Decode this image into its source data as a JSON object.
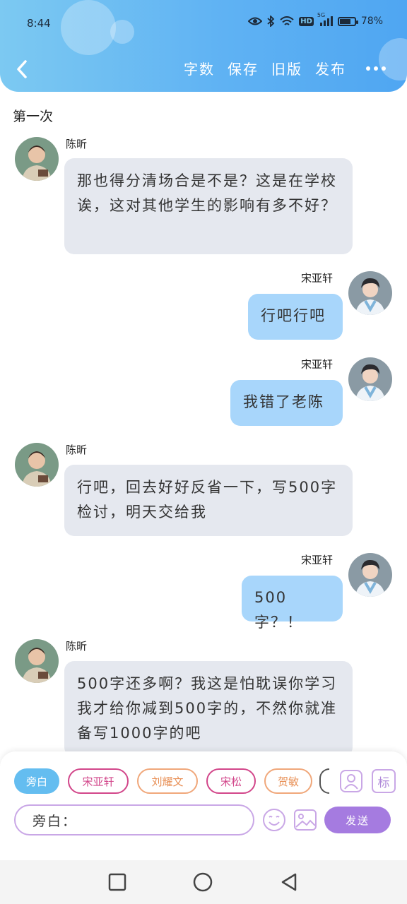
{
  "status_bar": {
    "time": "8:44",
    "network": "5G",
    "hd": "HD",
    "battery": "78%",
    "battery_level": 0.78
  },
  "nav": {
    "actions": [
      "字数",
      "保存",
      "旧版",
      "发布"
    ]
  },
  "chapter": {
    "title": "第一次"
  },
  "messages": [
    {
      "side": "left",
      "name": "陈昕",
      "text": "那也得分清场合是不是？这是在学校诶，这对其他学生的影响有多不好？"
    },
    {
      "side": "right",
      "name": "宋亚轩",
      "text": "行吧行吧"
    },
    {
      "side": "right",
      "name": "宋亚轩",
      "text": "我错了老陈"
    },
    {
      "side": "left",
      "name": "陈昕",
      "text": "行吧，回去好好反省一下，写500字检讨，明天交给我"
    },
    {
      "side": "right",
      "name": "宋亚轩",
      "text": "500字？！"
    },
    {
      "side": "left",
      "name": "陈昕",
      "text": "500字还多啊？我这是怕耽误你学习我才给你减到500字的，不然你就准备写1000字的吧"
    }
  ],
  "roles": [
    "旁白",
    "宋亚轩",
    "刘耀文",
    "宋松",
    "贺敏"
  ],
  "composer": {
    "input_value": "旁白：",
    "send_label": "发送",
    "tag_label": "标"
  },
  "colors": {
    "header": "#5fb2f3",
    "send": "#a57be0",
    "right_bubble": "#a8d6fb",
    "left_bubble": "#e5e8ef"
  }
}
